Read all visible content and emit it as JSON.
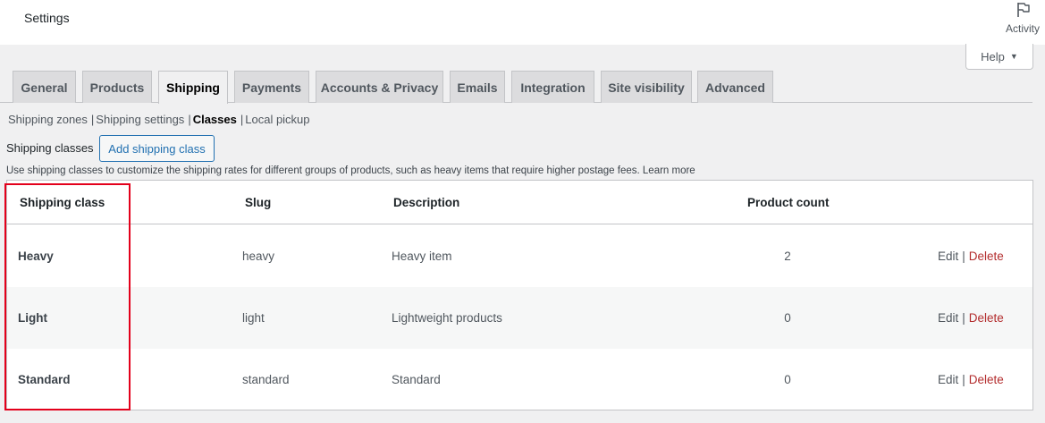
{
  "header": {
    "title": "Settings",
    "activity_label": "Activity",
    "help_label": "Help"
  },
  "tabs": [
    {
      "label": "General"
    },
    {
      "label": "Products"
    },
    {
      "label": "Shipping"
    },
    {
      "label": "Payments"
    },
    {
      "label": "Accounts & Privacy"
    },
    {
      "label": "Emails"
    },
    {
      "label": "Integration"
    },
    {
      "label": "Site visibility"
    },
    {
      "label": "Advanced"
    }
  ],
  "subnav": [
    {
      "label": "Shipping zones"
    },
    {
      "label": "Shipping settings"
    },
    {
      "label": "Classes"
    },
    {
      "label": "Local pickup"
    }
  ],
  "classes": {
    "heading": "Shipping classes",
    "add_button": "Add shipping class",
    "description": "Use shipping classes to customize the shipping rates for different groups of products, such as heavy items that require higher postage fees. Learn more"
  },
  "table": {
    "columns": [
      "Shipping class",
      "Slug",
      "Description",
      "Product count"
    ],
    "rows": [
      {
        "name": "Heavy",
        "slug": "heavy",
        "description": "Heavy item",
        "count": "2"
      },
      {
        "name": "Light",
        "slug": "light",
        "description": "Lightweight products",
        "count": "0"
      },
      {
        "name": "Standard",
        "slug": "standard",
        "description": "Standard",
        "count": "0"
      }
    ],
    "edit_label": "Edit",
    "separator": "|",
    "delete_label": "Delete"
  },
  "colors": {
    "accent": "#2271b1",
    "delete": "#b32d2e",
    "highlight": "#e3001b"
  }
}
